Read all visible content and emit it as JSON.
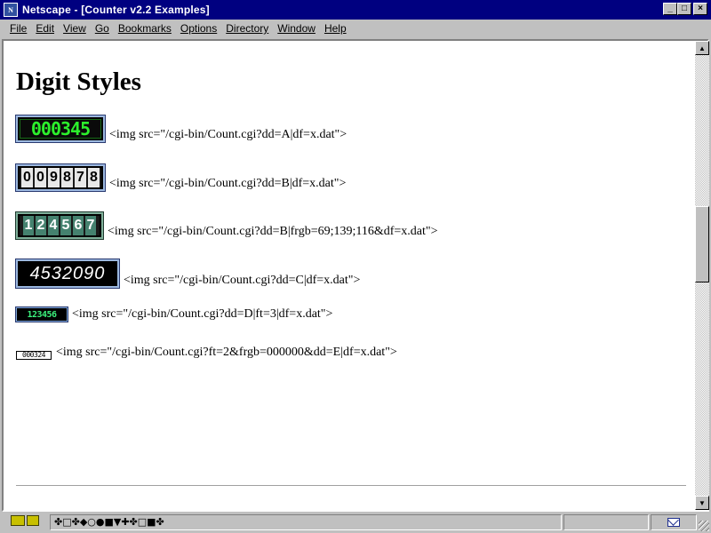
{
  "window": {
    "title": "Netscape - [Counter v2.2 Examples]",
    "app_icon_text": "N",
    "minimize": "_",
    "maximize": "□",
    "close": "×"
  },
  "menu": [
    "File",
    "Edit",
    "View",
    "Go",
    "Bookmarks",
    "Options",
    "Directory",
    "Window",
    "Help"
  ],
  "menu_underline_index": [
    0,
    0,
    0,
    0,
    0,
    0,
    0,
    0,
    0
  ],
  "page": {
    "title": "Digit Styles",
    "examples": [
      {
        "digits": "000345",
        "code": "<img src=\"/cgi-bin/Count.cgi?dd=A|df=x.dat\">"
      },
      {
        "digits": "009878",
        "code": "<img src=\"/cgi-bin/Count.cgi?dd=B|df=x.dat\">"
      },
      {
        "digits": "124567",
        "code": "<img src=\"/cgi-bin/Count.cgi?dd=B|frgb=69;139;116&df=x.dat\">"
      },
      {
        "digits": "4532090",
        "code": "<img src=\"/cgi-bin/Count.cgi?dd=C|df=x.dat\">"
      },
      {
        "digits": "123456",
        "code": "<img src=\"/cgi-bin/Count.cgi?dd=D|ft=3|df=x.dat\">"
      },
      {
        "digits": "000324",
        "code": "<img src=\"/cgi-bin/Count.cgi?ft=2&frgb=000000&dd=E|df=x.dat\">"
      }
    ]
  },
  "statusbar": {
    "text": "✤□✤◆○●■▼✚✤□■✤"
  },
  "colors": {
    "titlebar": "#000080",
    "chrome": "#c0c0c0",
    "counter_a_digits": "#2cf02c",
    "counter_b2_digits": "#45826f"
  }
}
